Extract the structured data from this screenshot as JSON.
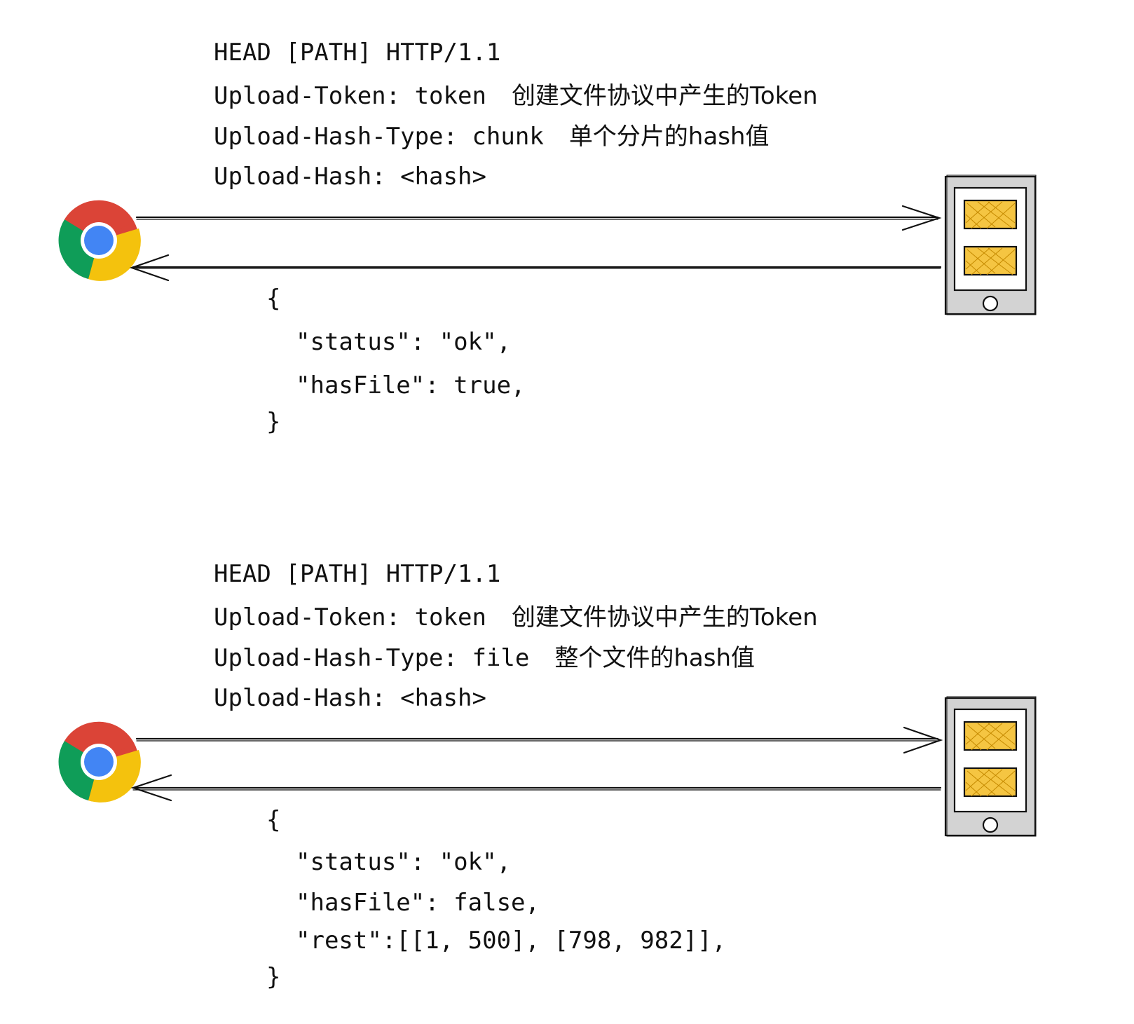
{
  "exchanges": [
    {
      "request": {
        "start_line": "HEAD [PATH] HTTP/1.1",
        "headers": [
          {
            "text": "Upload-Token: token",
            "note": "创建文件协议中产生的Token"
          },
          {
            "text": "Upload-Hash-Type: chunk",
            "note": "单个分片的hash值"
          },
          {
            "text": "Upload-Hash: <hash>",
            "note": ""
          }
        ]
      },
      "response": {
        "open": "{",
        "lines": [
          "\"status\": \"ok\",",
          "\"hasFile\": true,"
        ],
        "close": "}"
      }
    },
    {
      "request": {
        "start_line": "HEAD [PATH] HTTP/1.1",
        "headers": [
          {
            "text": "Upload-Token: token",
            "note": "创建文件协议中产生的Token"
          },
          {
            "text": "Upload-Hash-Type: file",
            "note": "整个文件的hash值"
          },
          {
            "text": "Upload-Hash: <hash>",
            "note": ""
          }
        ]
      },
      "response": {
        "open": "{",
        "lines": [
          "\"status\": \"ok\",",
          "\"hasFile\": false,",
          "\"rest\":[[1, 500], [798, 982]],"
        ],
        "close": "}"
      }
    }
  ],
  "icons": {
    "client": "chrome-browser-icon",
    "server": "tablet-server-icon",
    "request_arrow": "arrow-right-icon",
    "response_arrow": "arrow-left-icon"
  },
  "colors": {
    "chrome_red": "#DB4437",
    "chrome_yellow": "#F4C20D",
    "chrome_green": "#0F9D58",
    "chrome_blue": "#4285F4",
    "device_body": "#d3d3d3",
    "device_panel": "#f5c542"
  }
}
